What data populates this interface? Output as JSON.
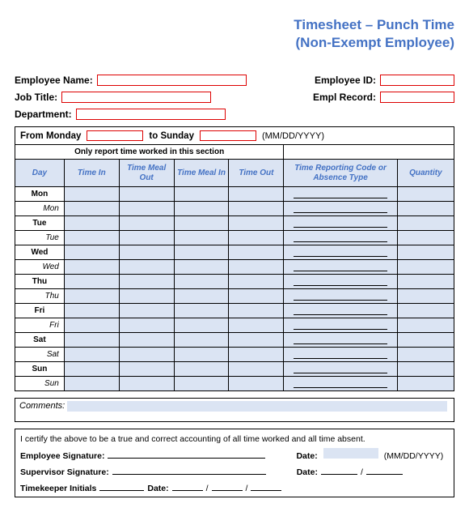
{
  "title_line1": "Timesheet – Punch Time",
  "title_line2": "(Non-Exempt Employee)",
  "header": {
    "emp_name": "Employee Name:",
    "job_title": "Job Title:",
    "department": "Department:",
    "emp_id": "Employee ID:",
    "empl_record": "Empl Record:"
  },
  "range": {
    "from": "From Monday",
    "to": "to Sunday",
    "hint": "(MM/DD/YYYY)"
  },
  "section_label_time": "Only report time worked in this section",
  "cols": {
    "day": "Day",
    "time_in": "Time In",
    "meal_out": "Time Meal Out",
    "meal_in": "Time Meal In",
    "time_out": "Time Out",
    "code": "Time Reporting Code or Absence Type",
    "qty": "Quantity"
  },
  "days": [
    "Mon",
    "Tue",
    "Wed",
    "Thu",
    "Fri",
    "Sat",
    "Sun"
  ],
  "comments_label": "Comments:",
  "cert": "I certify the above to be a true and correct accounting of all time worked and all time absent.",
  "sig": {
    "emp": "Employee Signature:",
    "sup": "Supervisor Signature:",
    "tk": "Timekeeper Initials",
    "date": "Date:",
    "date_hint": "(MM/DD/YYYY)"
  }
}
